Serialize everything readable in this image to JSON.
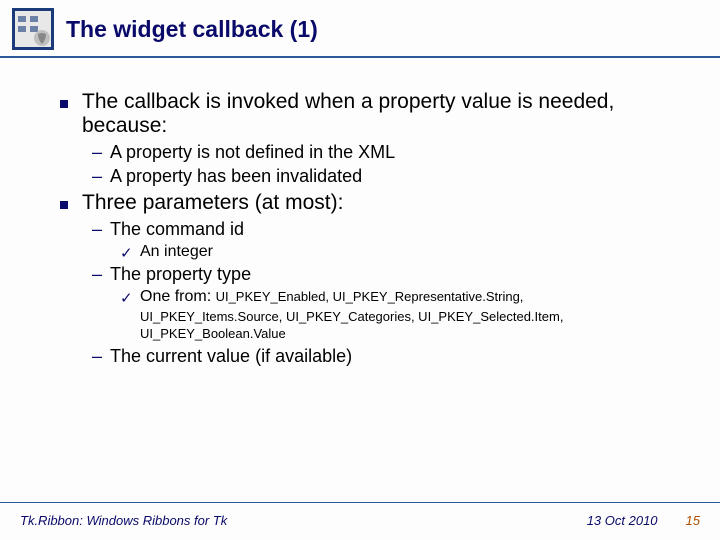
{
  "title": "The widget callback (1)",
  "bullets": {
    "b1_0": "The callback is invoked when a property value is needed, because:",
    "b2_0": "A property is not defined in the XML",
    "b2_1": "A property has been invalidated",
    "b1_1": "Three parameters (at most):",
    "b2_2": "The command id",
    "b3_0": "An integer",
    "b2_3": "The property type",
    "b3_1_prefix": "One from: ",
    "b3_1_enum1": "UI_PKEY_Enabled, UI_PKEY_Representative.String,",
    "b3_1_enum2": "UI_PKEY_Items.Source, UI_PKEY_Categories, UI_PKEY_Selected.Item, UI_PKEY_Boolean.Value",
    "b2_4": "The current value (if available)"
  },
  "footer": {
    "left": "Tk.Ribbon: Windows Ribbons for Tk",
    "date": "13 Oct 2010",
    "page": "15"
  }
}
